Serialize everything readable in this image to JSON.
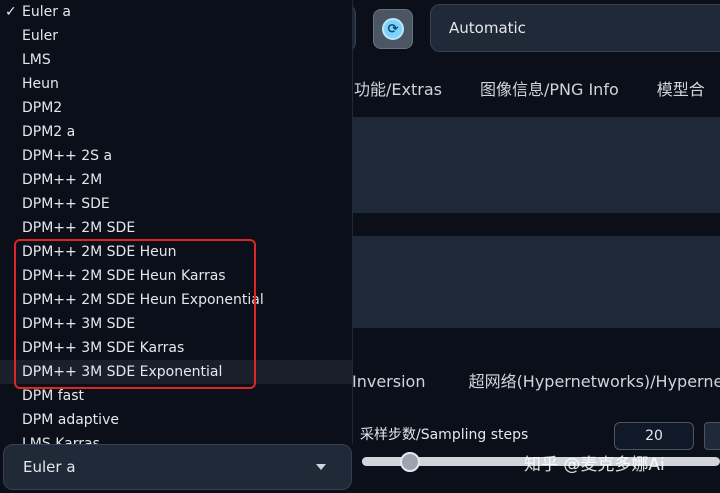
{
  "header": {
    "model_select_value": "Automatic",
    "refresh_icon": "refresh-icon"
  },
  "tabs": {
    "extras": "功能/Extras",
    "png_info": "图像信息/PNG Info",
    "merge": "模型合"
  },
  "subtabs": {
    "textual_inversion": "Inversion",
    "hypernetworks": "超网络(Hypernetworks)/Hypernet"
  },
  "sampling": {
    "steps_label": "采样步数/Sampling steps",
    "steps_value": "20",
    "steps_slider_fraction": 0.13
  },
  "sampler": {
    "selected": "Euler a",
    "options": [
      "Euler a",
      "Euler",
      "LMS",
      "Heun",
      "DPM2",
      "DPM2 a",
      "DPM++ 2S a",
      "DPM++ 2M",
      "DPM++ SDE",
      "DPM++ 2M SDE",
      "DPM++ 2M SDE Heun",
      "DPM++ 2M SDE Heun Karras",
      "DPM++ 2M SDE Heun Exponential",
      "DPM++ 3M SDE",
      "DPM++ 3M SDE Karras",
      "DPM++ 3M SDE Exponential",
      "DPM fast",
      "DPM adaptive",
      "LMS Karras"
    ],
    "check_mark": "✓"
  },
  "colors": {
    "highlight": "#dc2626",
    "background": "#0b0f19",
    "panel": "#1f2937"
  },
  "watermark": "知乎 @麦克多娜Ai"
}
